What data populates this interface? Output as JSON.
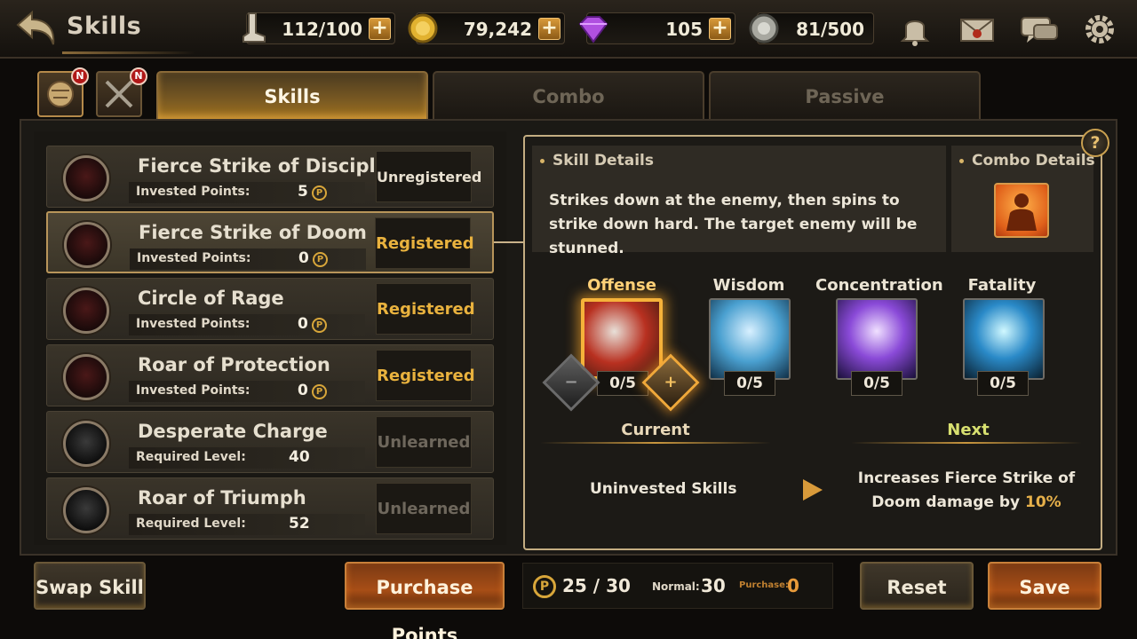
{
  "header": {
    "title": "Skills"
  },
  "resources": [
    {
      "icon": "stamina-boot-icon",
      "value": "112/100"
    },
    {
      "icon": "gold-coin-icon",
      "value": "79,242"
    },
    {
      "icon": "gem-icon",
      "value": "105"
    },
    {
      "icon": "silver-medal-icon",
      "value": "81/500"
    }
  ],
  "top_icons": [
    "bell-icon",
    "mail-icon",
    "chat-icon",
    "gear-icon"
  ],
  "mini_tabs": [
    {
      "icon": "tiger-emblem-icon",
      "badge": "N"
    },
    {
      "icon": "crossed-swords-icon",
      "badge": "N"
    }
  ],
  "tabs": [
    {
      "label": "Skills",
      "active": true
    },
    {
      "label": "Combo",
      "active": false
    },
    {
      "label": "Passive",
      "active": false
    }
  ],
  "skills": [
    {
      "name": "Fierce Strike of Discipline",
      "sub_label": "Invested Points:",
      "sub_value": "5",
      "coin": "P",
      "status": "Unregistered"
    },
    {
      "name": "Fierce Strike of Doom",
      "sub_label": "Invested Points:",
      "sub_value": "0",
      "coin": "P",
      "status": "Registered"
    },
    {
      "name": "Circle of Rage",
      "sub_label": "Invested Points:",
      "sub_value": "0",
      "coin": "P",
      "status": "Registered"
    },
    {
      "name": "Roar of Protection",
      "sub_label": "Invested Points:",
      "sub_value": "0",
      "coin": "P",
      "status": "Registered"
    },
    {
      "name": "Desperate Charge",
      "sub_label": "Required Level:",
      "sub_value": "40",
      "status": "Unlearned"
    },
    {
      "name": "Roar of Triumph",
      "sub_label": "Required Level:",
      "sub_value": "52",
      "status": "Unlearned"
    }
  ],
  "details": {
    "skill_details_title": "Skill Details",
    "skill_description": "Strikes down at the enemy, then spins to strike down hard. The target enemy will be stunned.",
    "combo_details_title": "Combo Details",
    "help": "?"
  },
  "paths": [
    {
      "label": "Offense",
      "count": "0/5",
      "active": true
    },
    {
      "label": "Wisdom",
      "count": "0/5",
      "active": false
    },
    {
      "label": "Concentration",
      "count": "0/5",
      "active": false
    },
    {
      "label": "Fatality",
      "count": "0/5",
      "active": false
    }
  ],
  "stepper": {
    "minus": "−",
    "plus": "+"
  },
  "current": {
    "label": "Current",
    "text": "Uninvested Skills"
  },
  "next": {
    "label": "Next",
    "text_before": "Increases Fierce Strike of Doom damage by ",
    "highlight": "10%"
  },
  "bottom": {
    "swap_skill": "Swap Skill",
    "purchase_points": "Purchase Points",
    "points_coin": "P",
    "points": "25 / 30",
    "normal_label": "Normal:",
    "normal_value": "30",
    "purchase_label": "Purchase:",
    "purchase_value": "0",
    "reset": "Reset",
    "save": "Save"
  },
  "colors": {
    "accent_gold": "#e9b23e",
    "orange_button": "#a84e16",
    "panel_border": "#c4ad82"
  }
}
